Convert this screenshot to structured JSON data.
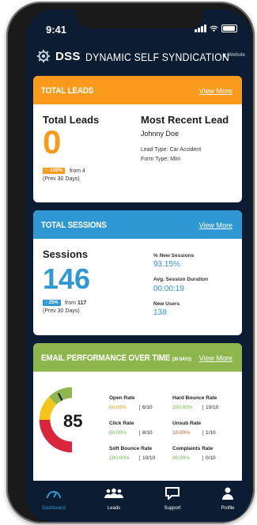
{
  "status": {
    "time": "9:41"
  },
  "header": {
    "brand": "DSS",
    "subtitle": "DYNAMIC SELF SYNDICATION",
    "back_label": "Website"
  },
  "leads": {
    "title": "TOTAL LEADS",
    "link": "View More",
    "total_label": "Total Leads",
    "total_value": "0",
    "change_badge": "↑ -100%",
    "change_from": "from 4",
    "period": "(Prev 30 Days)",
    "recent_label": "Most Recent Lead",
    "recent_name": "Johnny Doe",
    "lead_type": "Lead Type: Car Accident",
    "form_type": "Form Type: Mini"
  },
  "sessions": {
    "title": "TOTAL SESSIONS",
    "link": "View More",
    "label": "Sessions",
    "value": "146",
    "change_badge": "↑ 25%",
    "change_from_prefix": "from",
    "change_from_value": "117",
    "period": "(Prev 30 Days)",
    "new_sessions_label": "% New Sessions",
    "new_sessions_value": "93.15%",
    "avg_duration_label": "Avg. Session Duration",
    "avg_duration_value": "00:00:19",
    "new_users_label": "New Users",
    "new_users_value": "138"
  },
  "email": {
    "title": "EMAIL PERFORMANCE OVER TIME",
    "title_suffix": "(30 DAYS)",
    "link": "View More",
    "score": "85",
    "gauge_level": 0.85,
    "metrics": [
      {
        "label": "Open Rate",
        "pct": "60.00%",
        "frac": "6/10",
        "color": "yellow"
      },
      {
        "label": "Hard Bounce Rate",
        "pct": "100.00%",
        "frac": "10/10",
        "color": "green"
      },
      {
        "label": "Click Rate",
        "pct": "80.00%",
        "frac": "8/10",
        "color": "green"
      },
      {
        "label": "Unsub Rate",
        "pct": "10.00%",
        "frac": "1/10",
        "color": "red"
      },
      {
        "label": "Soft Bounce Rate",
        "pct": "100.00%",
        "frac": "10/10",
        "color": "green"
      },
      {
        "label": "Complaints Rate",
        "pct": "00.00%",
        "frac": "0/10",
        "color": "green"
      }
    ]
  },
  "tabs": [
    {
      "label": "Dashboard",
      "icon": "gauge-icon"
    },
    {
      "label": "Leads",
      "icon": "users-icon"
    },
    {
      "label": "Support",
      "icon": "chat-icon"
    },
    {
      "label": "Profile",
      "icon": "person-icon"
    }
  ],
  "colors": {
    "orange": "#f89a1c",
    "blue": "#2f98d3",
    "green": "#8db64c",
    "navy": "#0c1d33",
    "red": "#d9263a",
    "yellow": "#f5c518"
  }
}
